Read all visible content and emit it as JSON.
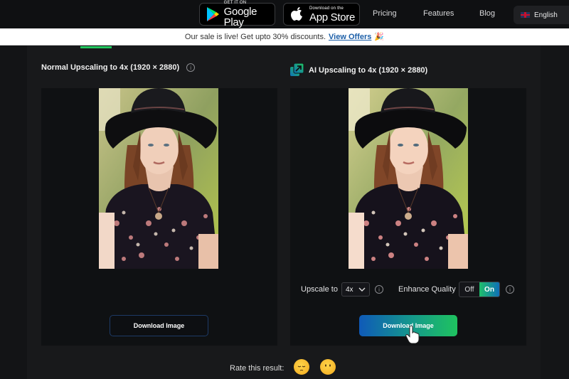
{
  "nav": {
    "google_play": {
      "small": "GET IT ON",
      "big": "Google Play",
      "icon": "google-play-icon"
    },
    "app_store": {
      "small": "Download on the",
      "big": "App Store",
      "icon": "apple-icon"
    },
    "links": [
      "Pricing",
      "Features",
      "Blog"
    ],
    "language": {
      "label": "English",
      "icon": "uk-flag-icon"
    }
  },
  "banner": {
    "text": "Our sale is live! Get upto 30% discounts.",
    "link": "View Offers",
    "emoji": "🎉"
  },
  "left_panel": {
    "title": "Normal Upscaling to 4x (1920 × 2880)",
    "info_icon": "i",
    "download_label": "Download Image"
  },
  "right_panel": {
    "title": "AI Upscaling to 4x (1920 × 2880)",
    "upscale_label": "Upscale to",
    "upscale_value": "4x",
    "enhance_label": "Enhance Quality",
    "toggle_off": "Off",
    "toggle_on": "On",
    "toggle_state": "On",
    "info_icon": "i",
    "download_label": "Download Image"
  },
  "rating": {
    "label": "Rate this result:",
    "options": [
      "😔",
      "😶"
    ]
  },
  "colors": {
    "accent_green": "#22c55e",
    "accent_blue": "#0f5ab8",
    "link_blue": "#1c5fa8"
  }
}
